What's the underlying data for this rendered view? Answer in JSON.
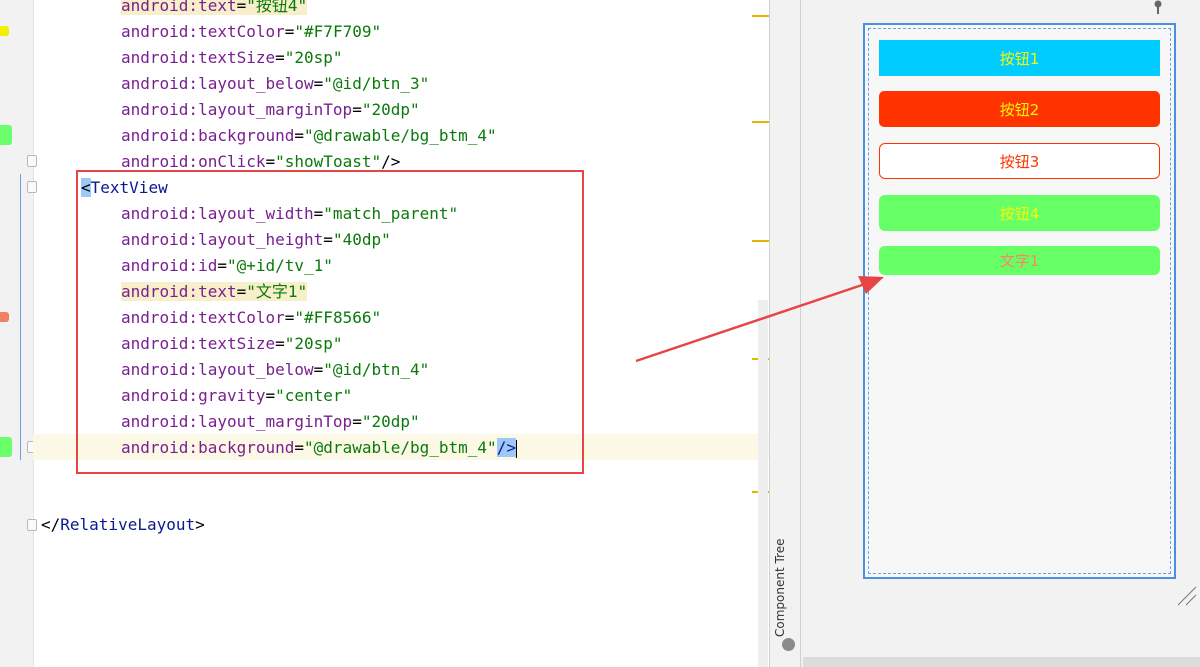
{
  "editor": {
    "lines": [
      {
        "indent": "    ",
        "attr": "android:text",
        "value": "\"按钮4\"",
        "warn": true
      },
      {
        "indent": "    ",
        "attr": "android:textColor",
        "value": "\"#F7F709\""
      },
      {
        "indent": "    ",
        "attr": "android:textSize",
        "value": "\"20sp\""
      },
      {
        "indent": "    ",
        "attr": "android:layout_below",
        "value": "\"@id/btn_3\""
      },
      {
        "indent": "    ",
        "attr": "android:layout_marginTop",
        "value": "\"20dp\""
      },
      {
        "indent": "    ",
        "attr": "android:background",
        "value": "\"@drawable/bg_btm_4\""
      },
      {
        "indent": "    ",
        "attr": "android:onClick",
        "value": "\"showToast\"",
        "tail": "/>"
      },
      {
        "tagline": true,
        "text": "TextView"
      },
      {
        "indent": "    ",
        "attr": "android:layout_width",
        "value": "\"match_parent\""
      },
      {
        "indent": "    ",
        "attr": "android:layout_height",
        "value": "\"40dp\""
      },
      {
        "indent": "    ",
        "attr": "android:id",
        "value": "\"@+id/tv_1\""
      },
      {
        "indent": "    ",
        "attr": "android:text",
        "value": "\"文字1\"",
        "warn": true
      },
      {
        "indent": "    ",
        "attr": "android:textColor",
        "value": "\"#FF8566\""
      },
      {
        "indent": "    ",
        "attr": "android:textSize",
        "value": "\"20sp\""
      },
      {
        "indent": "    ",
        "attr": "android:layout_below",
        "value": "\"@id/btn_4\""
      },
      {
        "indent": "    ",
        "attr": "android:gravity",
        "value": "\"center\""
      },
      {
        "indent": "    ",
        "attr": "android:layout_marginTop",
        "value": "\"20dp\""
      },
      {
        "indent": "    ",
        "attr": "android:background",
        "value": "\"@drawable/bg_btm_4\"",
        "tail_sel": "/>",
        "current": true
      }
    ],
    "closing_tag": "RelativeLayout"
  },
  "sidebar": {
    "component_tree_label": "Component Tree"
  },
  "preview": {
    "buttons": [
      {
        "label": "按钮1",
        "bg": "#00CCFF",
        "color": "#F7F709",
        "border": "none",
        "radius": "0"
      },
      {
        "label": "按钮2",
        "bg": "#FF3300",
        "color": "#F7F709",
        "border": "none",
        "radius": "5px"
      },
      {
        "label": "按钮3",
        "bg": "#FFFFFF",
        "color": "#FF3300",
        "border": "1px solid #FF3300",
        "radius": "6px"
      },
      {
        "label": "按钮4",
        "bg": "#66FF66",
        "color": "#F7F709",
        "border": "none",
        "radius": "6px"
      },
      {
        "label": "文字1",
        "bg": "#66FF66",
        "color": "#FF8566",
        "border": "none",
        "radius": "6px"
      }
    ]
  },
  "colors": {
    "highlight_box": "#E64545",
    "arrow": "#E64545",
    "attr": "#7A1F8F",
    "value": "#0B7A0B",
    "tag": "#0A1A8F"
  }
}
